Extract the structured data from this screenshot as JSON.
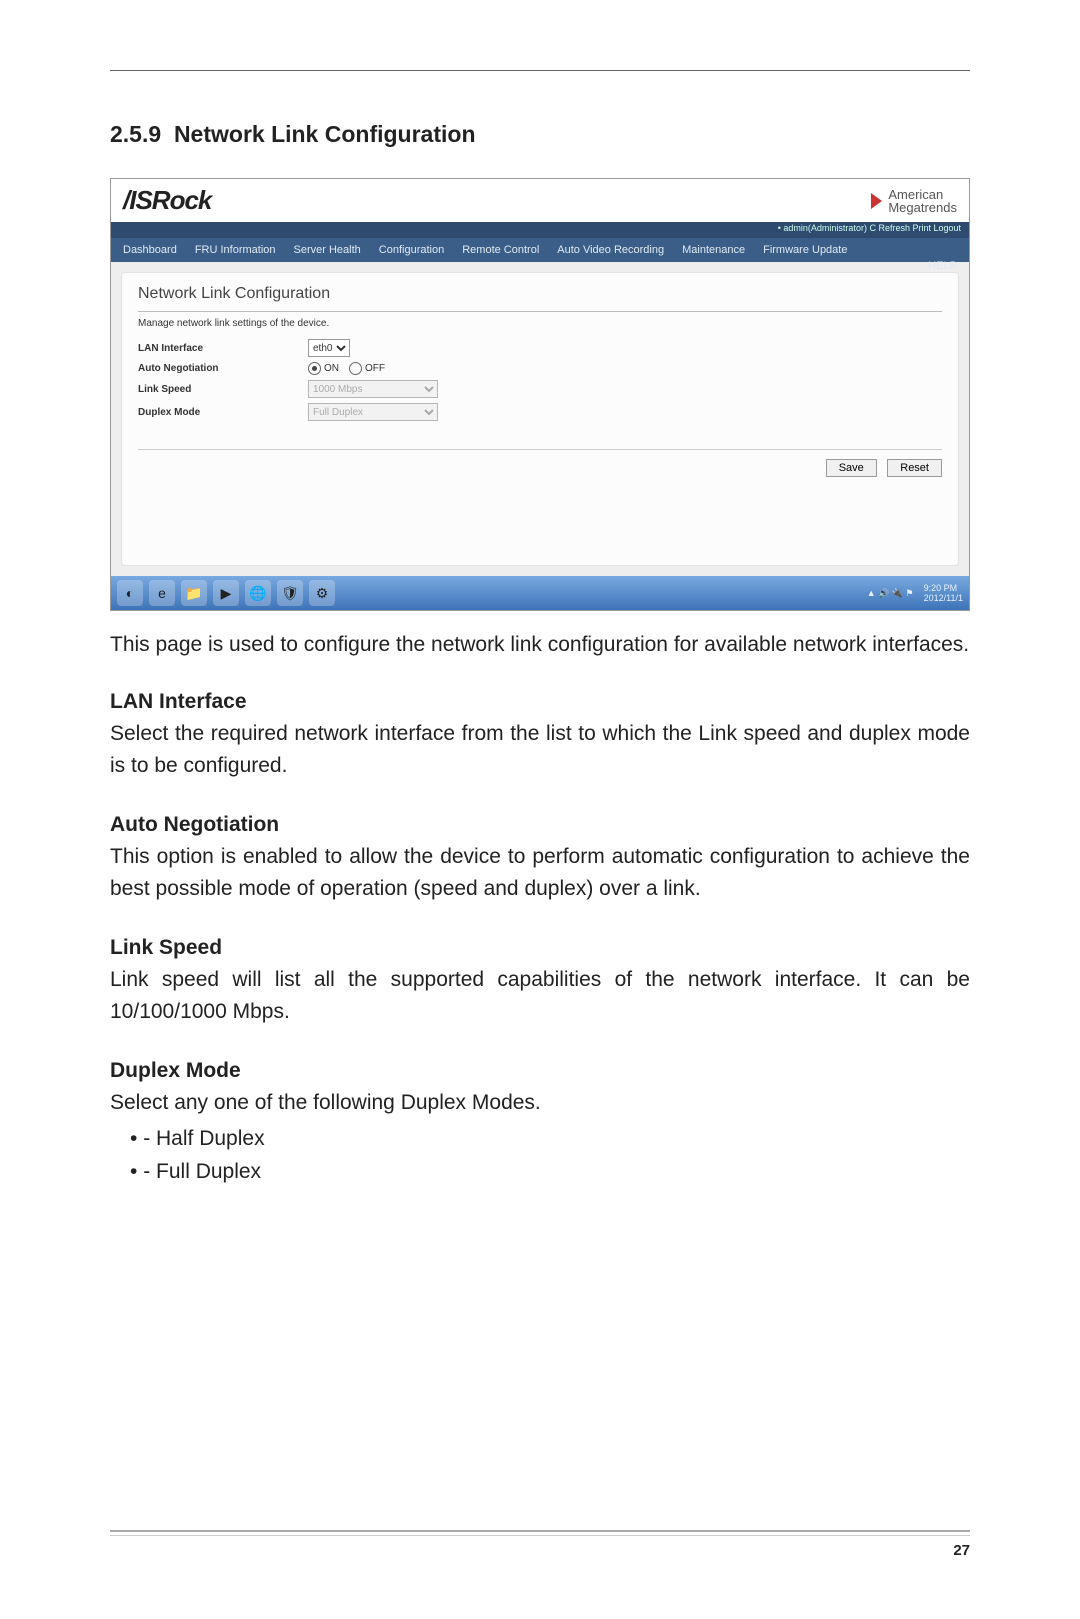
{
  "doc": {
    "section_number": "2.5.9",
    "section_title": "Network Link Configuration",
    "intro": "This page is used to configure the network link configuration for available network interfaces.",
    "lan": {
      "heading": "LAN Interface",
      "body": "Select the required network interface from the list to which the Link speed and duplex mode is to be configured."
    },
    "auto": {
      "heading": "Auto Negotiation",
      "body": "This option is enabled to allow the device to perform automatic configuration to achieve the best possible mode of operation (speed and duplex) over a link."
    },
    "speed": {
      "heading": "Link Speed",
      "body": "Link speed will list all the supported capabilities of the network interface. It can be 10/100/1000 Mbps."
    },
    "duplex": {
      "heading": "Duplex Mode",
      "body": "Select any one of the following Duplex Modes.",
      "items": [
        "- Half Duplex",
        "- Full Duplex"
      ]
    },
    "page_number": "27"
  },
  "screenshot": {
    "brand": "/ISRock",
    "amt_line1": "American",
    "amt_line2": "Megatrends",
    "status_bar": "• admin(Administrator)   C Refresh   Print   Logout",
    "menu": [
      "Dashboard",
      "FRU Information",
      "Server Health",
      "Configuration",
      "Remote Control",
      "Auto Video Recording",
      "Maintenance",
      "Firmware Update"
    ],
    "help_label": "HELP",
    "panel_title": "Network Link Configuration",
    "panel_sub": "Manage network link settings of the device.",
    "rows": {
      "lan": {
        "label": "LAN Interface",
        "value": "eth0"
      },
      "auto": {
        "label": "Auto Negotiation",
        "on": "ON",
        "off": "OFF"
      },
      "speed": {
        "label": "Link Speed",
        "value": "1000 Mbps"
      },
      "duplex": {
        "label": "Duplex Mode",
        "value": "Full Duplex"
      }
    },
    "buttons": {
      "save": "Save",
      "reset": "Reset"
    },
    "taskbar": {
      "icons": [
        "start-orb",
        "ie-icon",
        "folder-icon",
        "wmp-icon",
        "globe-icon",
        "shield-icon",
        "app-icon"
      ],
      "clock_line1": "9:20 PM",
      "clock_line2": "2012/11/1"
    }
  }
}
